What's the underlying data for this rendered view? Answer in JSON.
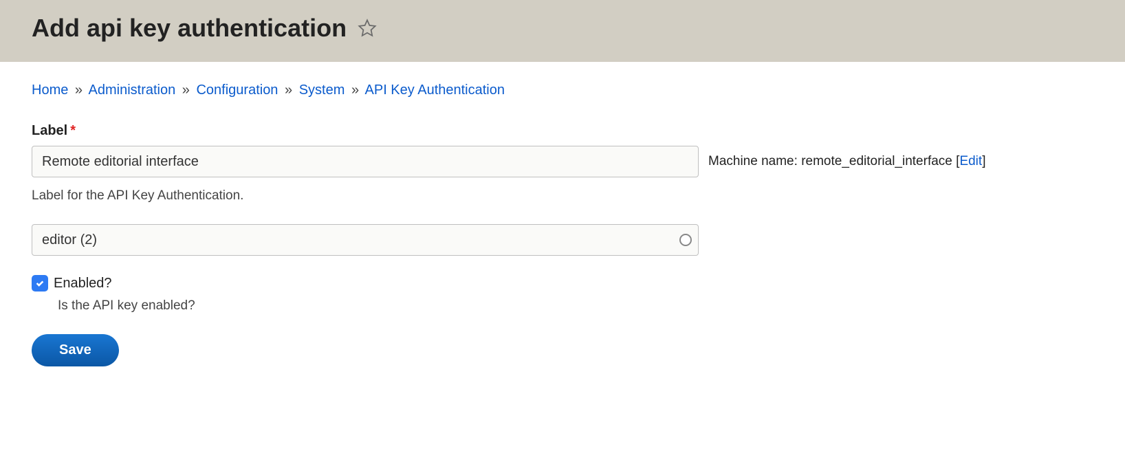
{
  "header": {
    "title": "Add api key authentication"
  },
  "breadcrumb": {
    "items": [
      {
        "label": "Home"
      },
      {
        "label": "Administration"
      },
      {
        "label": "Configuration"
      },
      {
        "label": "System"
      },
      {
        "label": "API Key Authentication"
      }
    ],
    "separator": "»"
  },
  "form": {
    "label": {
      "title": "Label",
      "value": "Remote editorial interface",
      "description": "Label for the API Key Authentication."
    },
    "machine_name": {
      "prefix": "Machine name:",
      "value": "remote_editorial_interface",
      "edit_label": "Edit"
    },
    "user_field": {
      "value": "editor (2)"
    },
    "enabled": {
      "label": "Enabled?",
      "checked": true,
      "description": "Is the API key enabled?"
    },
    "save_button": "Save"
  }
}
